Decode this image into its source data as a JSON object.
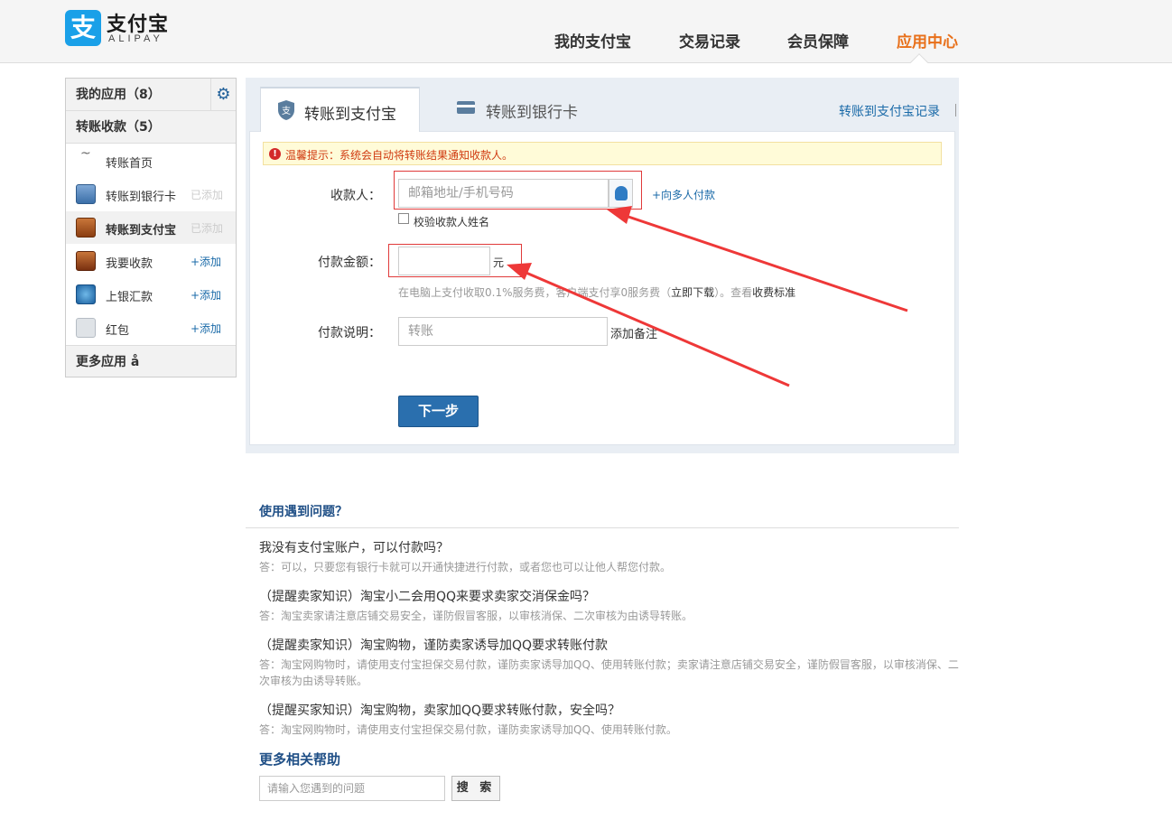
{
  "header": {
    "logo_glyph": "支",
    "logo_cn": "支付宝",
    "logo_en": "ALIPAY",
    "nav": [
      {
        "label": "我的支付宝",
        "active": false
      },
      {
        "label": "交易记录",
        "active": false
      },
      {
        "label": "会员保障",
        "active": false
      },
      {
        "label": "应用中心",
        "active": true
      }
    ]
  },
  "sidebar": {
    "my_apps": "我的应用（8）",
    "transfer_group": "转账收款（5）",
    "items": [
      {
        "label": "转账首页",
        "status": "",
        "icon": "tilde-icon"
      },
      {
        "label": "转账到银行卡",
        "status": "已添加",
        "icon": "bank-card-icon"
      },
      {
        "label": "转账到支付宝",
        "status": "已添加",
        "icon": "alipay-transfer-icon"
      },
      {
        "label": "我要收款",
        "status": "+添加",
        "icon": "receive-money-icon"
      },
      {
        "label": "上银汇款",
        "status": "+添加",
        "icon": "remittance-icon"
      },
      {
        "label": "红包",
        "status": "+添加",
        "icon": "red-envelope-icon"
      }
    ],
    "more_apps": "更多应用 å"
  },
  "tabs": {
    "to_alipay": "转账到支付宝",
    "to_bank": "转账到银行卡",
    "record_link": "转账到支付宝记录"
  },
  "notice": "温馨提示：系统会自动将转账结果通知收款人。",
  "form": {
    "payee_label": "收款人：",
    "payee_placeholder": "邮箱地址/手机号码",
    "multi_pay": "+向多人付款",
    "verify_name": "校验收款人姓名",
    "amount_label": "付款金额：",
    "amount_value": "",
    "currency": "元",
    "fee_text": "在电脑上支付收取0.1%服务费，客户端支付享0服务费（",
    "fee_download": "立即下载",
    "fee_text2": "）。查看",
    "fee_standard": "收费标准",
    "note_label": "付款说明：",
    "note_placeholder": "转账",
    "add_note": "添加备注",
    "next_button": "下一步"
  },
  "help": {
    "title": "使用遇到问题？",
    "faq": [
      {
        "q": "我没有支付宝账户，可以付款吗？",
        "a": "答：可以，只要您有银行卡就可以开通快捷进行付款，或者您也可以让他人帮您付款。"
      },
      {
        "q": "（提醒卖家知识）淘宝小二会用QQ来要求卖家交消保金吗？",
        "a": "答：淘宝卖家请注意店铺交易安全，谨防假冒客服，以审核消保、二次审核为由诱导转账。"
      },
      {
        "q": "（提醒卖家知识）淘宝购物，谨防卖家诱导加QQ要求转账付款",
        "a": "答：淘宝网购物时，请使用支付宝担保交易付款，谨防卖家诱导加QQ、使用转账付款；卖家请注意店铺交易安全，谨防假冒客服，以审核消保、二次审核为由诱导转账。"
      },
      {
        "q": "（提醒买家知识）淘宝购物，卖家加QQ要求转账付款，安全吗？",
        "a": "答：淘宝网购物时，请使用支付宝担保交易付款，谨防卖家诱导加QQ、使用转账付款。"
      }
    ],
    "more_help": "更多相关帮助",
    "search_placeholder": "请输入您遇到的问题",
    "search_button": "搜 索"
  },
  "colors": {
    "brand": "#1aa0e8",
    "nav_active": "#e8701a",
    "link": "#1a6aa8",
    "button": "#2a6fae",
    "annotation": "#e03a3a"
  }
}
